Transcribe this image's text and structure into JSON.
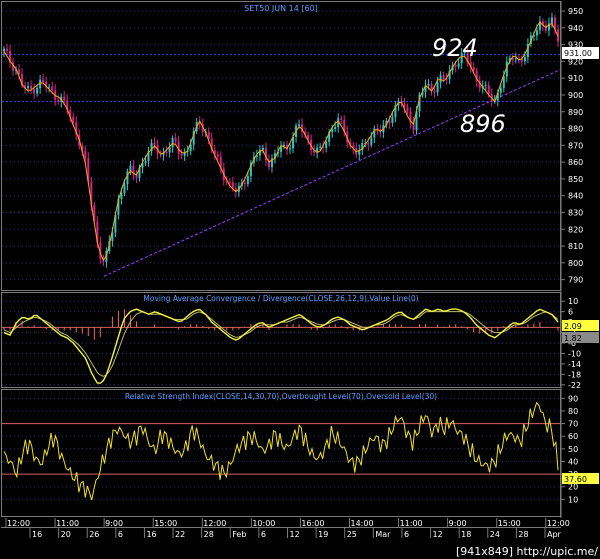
{
  "colors": {
    "background": "#000000",
    "frame": "#7a7a7a",
    "grid": "#2a2a7a",
    "title": "#5aa0ff",
    "axis_text": "#ffffff",
    "price_up": "#25c8c8",
    "price_down": "#d8208c",
    "price_ma": "#ffa500",
    "support_line": "#9b3cff",
    "hline": "#3a3aff",
    "macd": "#f4f43a",
    "macd_signal": "#bdbd6a",
    "macd_hist": "#ff6060",
    "rsi": "#f0e020",
    "rsi_levels": "#d86060",
    "badge_yellow": "#ffff40",
    "badge_gray": "#8a8a8a",
    "badge_white": "#ffffff"
  },
  "footer_text": "[941x849] http://upic.me/",
  "chart_data": [
    {
      "type": "candlestick",
      "title": "SET50 JUN 14  [60]",
      "ylim": [
        785,
        953
      ],
      "y_ticks": [
        790,
        800,
        810,
        820,
        830,
        840,
        850,
        860,
        870,
        880,
        890,
        900,
        910,
        920,
        930,
        940,
        950
      ],
      "last_value_label": "931.00",
      "annotations": [
        "924",
        "896"
      ],
      "reference_levels": [
        924,
        896
      ],
      "trendline": {
        "start": 792,
        "end": 915
      },
      "x_time_labels": [
        "12:00",
        "11:00",
        "9:00",
        "15:00",
        "12:00",
        "10:00",
        "16:00",
        "14:00",
        "11:00",
        "9:00",
        "15:00",
        "12:00"
      ],
      "x_date_labels": [
        "16",
        "20",
        "26",
        "6",
        "16",
        "22",
        "28",
        "Feb",
        "6",
        "12",
        "19",
        "25",
        "Mar",
        "6",
        "12",
        "18",
        "24",
        "28",
        "Apr"
      ],
      "close_path": [
        926,
        920,
        915,
        905,
        902,
        905,
        908,
        904,
        900,
        898,
        892,
        882,
        873,
        858,
        832,
        808,
        800,
        815,
        835,
        848,
        855,
        852,
        860,
        866,
        870,
        864,
        868,
        872,
        866,
        865,
        875,
        885,
        878,
        868,
        860,
        852,
        845,
        842,
        848,
        856,
        864,
        868,
        860,
        862,
        870,
        868,
        876,
        882,
        875,
        868,
        865,
        872,
        880,
        885,
        879,
        870,
        866,
        868,
        874,
        880,
        878,
        884,
        892,
        897,
        888,
        882,
        898,
        906,
        902,
        910,
        908,
        915,
        921,
        924,
        918,
        910,
        905,
        900,
        896,
        908,
        918,
        924,
        920,
        926,
        935,
        944,
        940,
        943,
        935
      ]
    },
    {
      "type": "line",
      "title": "Moving Average Convergence / Divergence(CLOSE,26,12,9),Value Line(0)",
      "ylim": [
        -24,
        12
      ],
      "y_ticks": [
        10,
        6,
        2,
        -2,
        -6,
        -10,
        -14,
        -18,
        -22
      ],
      "value_labels": [
        "2.09",
        "1.82"
      ],
      "zero_line": 0,
      "series": [
        {
          "values": [
            -2,
            -3,
            2,
            4,
            3,
            5,
            3,
            1,
            -1,
            -3,
            -4,
            -6,
            -9,
            -12,
            -18,
            -22,
            -20,
            -13,
            -5,
            3,
            6,
            7,
            6,
            5,
            6,
            5,
            4,
            3,
            2,
            4,
            6,
            7,
            5,
            2,
            0,
            -2,
            -4,
            -5,
            -3,
            -1,
            1,
            2,
            0,
            1,
            2,
            3,
            4,
            5,
            3,
            1,
            0,
            1,
            3,
            4,
            3,
            1,
            0,
            -1,
            0,
            1,
            2,
            3,
            5,
            6,
            4,
            3,
            5,
            7,
            6,
            7,
            6,
            7,
            7,
            6,
            4,
            1,
            -1,
            -3,
            -4,
            -2,
            0,
            2,
            1,
            3,
            5,
            7,
            6,
            5,
            2
          ]
        },
        {
          "values": [
            -1,
            -2,
            0,
            2,
            3,
            4,
            3,
            2,
            0,
            -2,
            -3,
            -5,
            -7,
            -10,
            -14,
            -18,
            -19,
            -16,
            -10,
            -3,
            2,
            5,
            6,
            5,
            5,
            5,
            4,
            3,
            3,
            3,
            5,
            6,
            5,
            3,
            1,
            -1,
            -3,
            -4,
            -3,
            -2,
            0,
            1,
            1,
            1,
            2,
            2,
            3,
            4,
            3,
            2,
            1,
            1,
            2,
            3,
            3,
            2,
            1,
            0,
            0,
            1,
            1,
            2,
            4,
            5,
            4,
            3,
            4,
            6,
            6,
            6,
            6,
            6,
            6,
            6,
            5,
            3,
            1,
            -1,
            -2,
            -2,
            -1,
            1,
            1,
            2,
            4,
            5,
            6,
            5,
            3
          ]
        }
      ]
    },
    {
      "type": "line",
      "title": "Relative Strength Index(CLOSE,14,30,70),Overbought Level(70),Oversold Level(30)",
      "ylim": [
        0,
        95
      ],
      "y_ticks": [
        90,
        80,
        70,
        60,
        50,
        40,
        30,
        20,
        10
      ],
      "levels": [
        70,
        30
      ],
      "value_label": "37.60",
      "values": [
        45,
        40,
        30,
        48,
        55,
        42,
        38,
        52,
        60,
        45,
        35,
        28,
        22,
        18,
        12,
        30,
        45,
        58,
        66,
        62,
        55,
        60,
        68,
        55,
        48,
        62,
        58,
        50,
        45,
        52,
        66,
        58,
        45,
        40,
        35,
        30,
        38,
        50,
        55,
        60,
        58,
        48,
        52,
        62,
        55,
        50,
        60,
        66,
        55,
        45,
        42,
        50,
        62,
        58,
        50,
        40,
        38,
        45,
        55,
        60,
        52,
        58,
        70,
        76,
        62,
        55,
        68,
        78,
        62,
        70,
        66,
        72,
        64,
        60,
        50,
        42,
        38,
        36,
        40,
        52,
        62,
        60,
        55,
        68,
        80,
        86,
        70,
        66,
        38
      ]
    }
  ]
}
